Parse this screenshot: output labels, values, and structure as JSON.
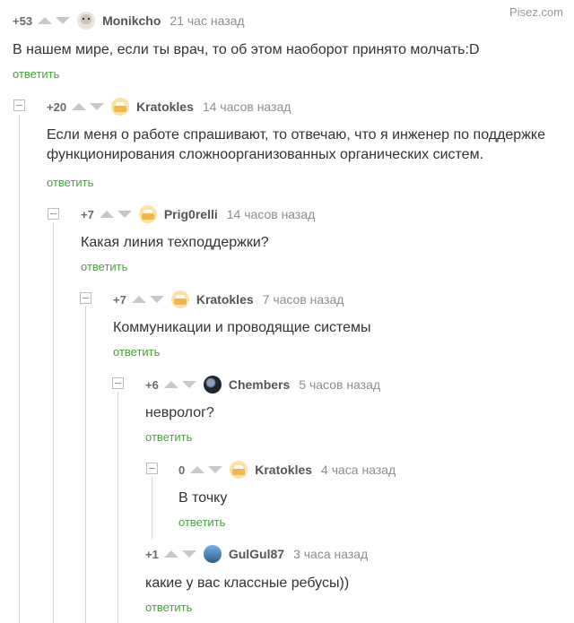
{
  "watermark": "Pisez.com",
  "reply_label": "ответить",
  "colors": {
    "reply_link": "#49a33e",
    "thread_line": "#d8d8d8",
    "vote_arrow": "#c8c8c8"
  },
  "comments": [
    {
      "rating": "+53",
      "author": "Monikcho",
      "time": "21 час назад",
      "avatar": "skull-avatar",
      "lines": [
        "В нашем мире, если ты врач, то об этом наоборот принято молчать:D"
      ]
    },
    {
      "rating": "+20",
      "author": "Kratokles",
      "time": "14 часов назад",
      "avatar": "cake-avatar",
      "lines": [
        "Если меня о работе спрашивают, то отвечаю, что я инженер по поддержке",
        "функционирования сложноорганизованных органических систем."
      ]
    },
    {
      "rating": "+7",
      "author": "Prig0relli",
      "time": "14 часов назад",
      "avatar": "cake-avatar",
      "lines": [
        "Какая линия техподдержки?"
      ]
    },
    {
      "rating": "+7",
      "author": "Kratokles",
      "time": "7 часов назад",
      "avatar": "cake-avatar",
      "lines": [
        "Коммуникации и проводящие системы"
      ]
    },
    {
      "rating": "+6",
      "author": "Chembers",
      "time": "5 часов назад",
      "avatar": "dark-avatar",
      "lines": [
        "невролог?"
      ]
    },
    {
      "rating": "0",
      "author": "Kratokles",
      "time": "4 часа назад",
      "avatar": "cake-avatar",
      "lines": [
        "В точку"
      ]
    },
    {
      "rating": "+1",
      "author": "GulGul87",
      "time": "3 часа назад",
      "avatar": "blue-avatar",
      "lines": [
        "какие у вас классные ребусы))"
      ]
    }
  ]
}
